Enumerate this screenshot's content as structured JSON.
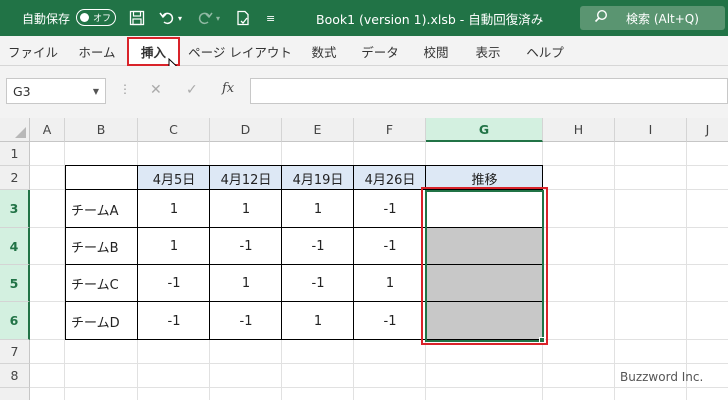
{
  "titlebar": {
    "autosave_label": "自動保存",
    "autosave_state": "オフ",
    "filename": "Book1 (version 1).xlsb  -  自動回復済み",
    "search_placeholder": "検索 (Alt+Q)",
    "bg_color": "#217346"
  },
  "ribbon": {
    "tabs": [
      {
        "label": "ファイル"
      },
      {
        "label": "ホーム"
      },
      {
        "label": "挿入"
      },
      {
        "label": "ページ レイアウト"
      },
      {
        "label": "数式"
      },
      {
        "label": "データ"
      },
      {
        "label": "校閲"
      },
      {
        "label": "表示"
      },
      {
        "label": "ヘルプ"
      }
    ],
    "active_tab": "挿入"
  },
  "formulabar": {
    "name_box": "G3",
    "fx": "fx",
    "formula": ""
  },
  "grid": {
    "columns": [
      "A",
      "B",
      "C",
      "D",
      "E",
      "F",
      "G",
      "H",
      "I",
      "J"
    ],
    "rows": [
      "1",
      "2",
      "3",
      "4",
      "5",
      "6",
      "7",
      "8"
    ],
    "header_row": {
      "c": "4月5日",
      "d": "4月12日",
      "e": "4月19日",
      "f": "4月26日",
      "g": "推移"
    },
    "teams": [
      {
        "name": "チームA",
        "values": [
          "1",
          "1",
          "1",
          "-1"
        ]
      },
      {
        "name": "チームB",
        "values": [
          "1",
          "-1",
          "-1",
          "-1"
        ]
      },
      {
        "name": "チームC",
        "values": [
          "-1",
          "1",
          "-1",
          "1"
        ]
      },
      {
        "name": "チームD",
        "values": [
          "-1",
          "-1",
          "1",
          "-1"
        ]
      }
    ],
    "selected_cell": "G3"
  },
  "watermark": "Buzzword Inc."
}
